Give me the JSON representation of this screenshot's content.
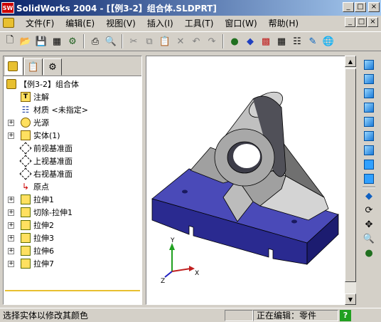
{
  "window": {
    "logo_text": "SW",
    "title": "SolidWorks 2004 - [【例3-2】组合体.SLDPRT]",
    "controls": [
      "_",
      "□",
      "×"
    ]
  },
  "menu": {
    "items": [
      "文件(F)",
      "编辑(E)",
      "视图(V)",
      "插入(I)",
      "工具(T)",
      "窗口(W)",
      "帮助(H)"
    ],
    "doc_controls": [
      "_",
      "□",
      "×"
    ]
  },
  "toolbar": {
    "icons": [
      "new-icon",
      "open-icon",
      "save-icon",
      "print-preview-icon",
      "options-icon",
      "print-icon",
      "preview-icon",
      "cut-icon",
      "copy-icon",
      "paste-icon",
      "delete-icon",
      "undo-icon",
      "redo-icon",
      "traffic-light-icon",
      "edit-color-icon",
      "color-palette-icon",
      "grid-icon",
      "table-icon",
      "sketch-icon",
      "globe-icon"
    ]
  },
  "feature_tree": {
    "tabs": [
      "feature-manager-tab",
      "property-manager-tab",
      "configuration-manager-tab"
    ],
    "root": "【例3-2】组合体",
    "items": [
      {
        "label": "注解",
        "icon": "annotation-icon",
        "expandable": false
      },
      {
        "label": "材质 <未指定>",
        "icon": "material-icon",
        "expandable": false
      },
      {
        "label": "光源",
        "icon": "lighting-icon",
        "expandable": true
      },
      {
        "label": "实体(1)",
        "icon": "solid-bodies-icon",
        "expandable": true
      },
      {
        "label": "前视基准面",
        "icon": "plane-icon",
        "expandable": false
      },
      {
        "label": "上视基准面",
        "icon": "plane-icon",
        "expandable": false
      },
      {
        "label": "右视基准面",
        "icon": "plane-icon",
        "expandable": false
      },
      {
        "label": "原点",
        "icon": "origin-icon",
        "expandable": false
      },
      {
        "label": "拉伸1",
        "icon": "extrude-icon",
        "expandable": true
      },
      {
        "label": "切除-拉伸1",
        "icon": "cut-extrude-icon",
        "expandable": true
      },
      {
        "label": "拉伸2",
        "icon": "extrude-icon",
        "expandable": true
      },
      {
        "label": "拉伸3",
        "icon": "extrude-icon",
        "expandable": true
      },
      {
        "label": "拉伸6",
        "icon": "extrude-icon",
        "expandable": true
      },
      {
        "label": "拉伸7",
        "icon": "extrude-icon",
        "expandable": true
      }
    ]
  },
  "triad": {
    "x": "X",
    "y": "Y",
    "z": "Z"
  },
  "right_toolbar": {
    "icons": [
      "front-view-icon",
      "back-view-icon",
      "left-view-icon",
      "right-view-icon",
      "top-view-icon",
      "bottom-view-icon",
      "isometric-view-icon",
      "normal-to-icon",
      "shaded-icon",
      "rotate-icon",
      "pan-icon",
      "zoom-icon",
      "traffic-light-icon"
    ]
  },
  "status": {
    "message": "选择实体以修改其颜色",
    "mode": "正在编辑：零件",
    "help": "?"
  },
  "colors": {
    "base_plate": "#4a4ab8",
    "support": "#a0a0a0",
    "title_bar": "#0a246a"
  }
}
